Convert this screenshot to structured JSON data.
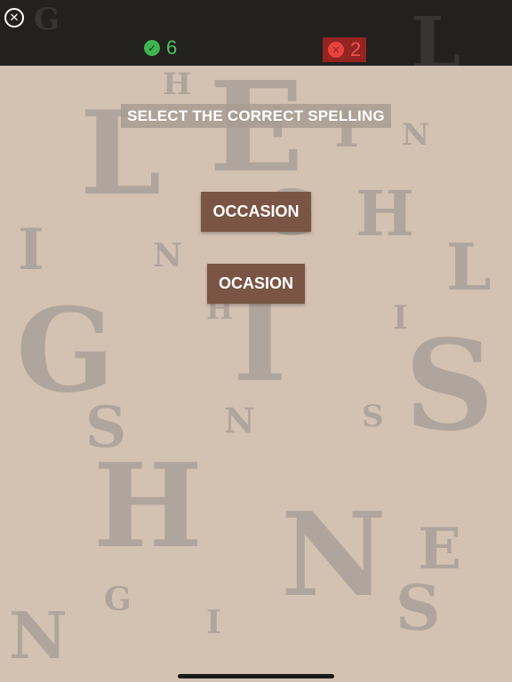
{
  "header": {
    "close_icon": "close-circle-icon",
    "correct_icon": "check-circle-icon",
    "wrong_icon": "x-circle-icon",
    "correct_count": "6",
    "wrong_count": "2",
    "colors": {
      "correct": "#4cc35a",
      "wrong_bg": "#932420",
      "wrong_text": "#f0524f"
    }
  },
  "game": {
    "prompt": "SELECT THE CORRECT SPELLING",
    "choices": [
      "OCCASION",
      "OCASION"
    ],
    "choice_color": "#7a5445"
  },
  "background_letters": [
    {
      "char": "G"
    },
    {
      "char": "L"
    },
    {
      "char": "H"
    },
    {
      "char": "L"
    },
    {
      "char": "E"
    },
    {
      "char": "I"
    },
    {
      "char": "N"
    },
    {
      "char": "G"
    },
    {
      "char": "H"
    },
    {
      "char": "I"
    },
    {
      "char": "N"
    },
    {
      "char": "L"
    },
    {
      "char": "H"
    },
    {
      "char": "I"
    },
    {
      "char": "G"
    },
    {
      "char": "I"
    },
    {
      "char": "S"
    },
    {
      "char": "S"
    },
    {
      "char": "N"
    },
    {
      "char": "S"
    },
    {
      "char": "H"
    },
    {
      "char": "N"
    },
    {
      "char": "E"
    },
    {
      "char": "G"
    },
    {
      "char": "I"
    },
    {
      "char": "S"
    },
    {
      "char": "N"
    }
  ]
}
